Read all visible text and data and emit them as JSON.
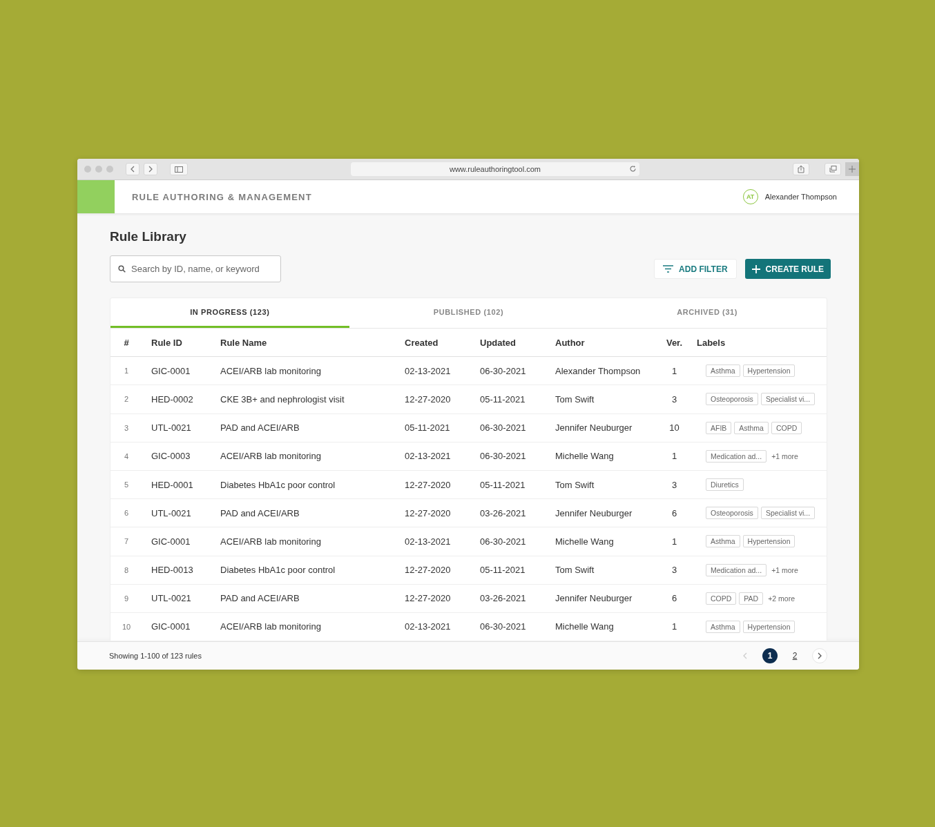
{
  "browser": {
    "url": "www.ruleauthoringtool.com"
  },
  "header": {
    "title": "RULE AUTHORING & MANAGEMENT",
    "user": {
      "initials": "AT",
      "name": "Alexander Thompson"
    }
  },
  "page": {
    "title": "Rule Library"
  },
  "search": {
    "placeholder": "Search by ID, name, or keyword"
  },
  "actions": {
    "filter": "ADD FILTER",
    "create": "CREATE RULE"
  },
  "tabs": [
    {
      "label": "IN PROGRESS (123)",
      "selected": true
    },
    {
      "label": "PUBLISHED (102)",
      "selected": false
    },
    {
      "label": "ARCHIVED (31)",
      "selected": false
    }
  ],
  "table": {
    "columns": [
      "#",
      "Rule ID",
      "Rule Name",
      "Created",
      "Updated",
      "Author",
      "Ver.",
      "Labels"
    ],
    "rows": [
      {
        "num": "1",
        "id": "GIC-0001",
        "name": "ACEI/ARB lab monitoring",
        "created": "02-13-2021",
        "updated": "06-30-2021",
        "author": "Alexander Thompson",
        "ver": "1",
        "labels": [
          "Asthma",
          "Hypertension"
        ]
      },
      {
        "num": "2",
        "id": "HED-0002",
        "name": "CKE 3B+ and nephrologist visit",
        "created": "12-27-2020",
        "updated": "05-11-2021",
        "author": "Tom Swift",
        "ver": "3",
        "labels": [
          "Osteoporosis",
          "Specialist vi..."
        ]
      },
      {
        "num": "3",
        "id": "UTL-0021",
        "name": "PAD and ACEI/ARB",
        "created": "05-11-2021",
        "updated": "06-30-2021",
        "author": "Jennifer Neuburger",
        "ver": "10",
        "labels": [
          "AFIB",
          "Asthma",
          "COPD"
        ]
      },
      {
        "num": "4",
        "id": "GIC-0003",
        "name": "ACEI/ARB lab monitoring",
        "created": "02-13-2021",
        "updated": "06-30-2021",
        "author": "Michelle Wang",
        "ver": "1",
        "labels": [
          "Medication ad..."
        ],
        "more": "+1 more"
      },
      {
        "num": "5",
        "id": "HED-0001",
        "name": "Diabetes HbA1c poor control",
        "created": "12-27-2020",
        "updated": "05-11-2021",
        "author": "Tom Swift",
        "ver": "3",
        "labels": [
          "Diuretics"
        ]
      },
      {
        "num": "6",
        "id": "UTL-0021",
        "name": "PAD and ACEI/ARB",
        "created": "12-27-2020",
        "updated": "03-26-2021",
        "author": "Jennifer Neuburger",
        "ver": "6",
        "labels": [
          "Osteoporosis",
          "Specialist vi..."
        ]
      },
      {
        "num": "7",
        "id": "GIC-0001",
        "name": "ACEI/ARB lab monitoring",
        "created": "02-13-2021",
        "updated": "06-30-2021",
        "author": "Michelle Wang",
        "ver": "1",
        "labels": [
          "Asthma",
          "Hypertension"
        ]
      },
      {
        "num": "8",
        "id": "HED-0013",
        "name": "Diabetes HbA1c poor control",
        "created": "12-27-2020",
        "updated": "05-11-2021",
        "author": "Tom Swift",
        "ver": "3",
        "labels": [
          "Medication ad..."
        ],
        "more": "+1 more"
      },
      {
        "num": "9",
        "id": "UTL-0021",
        "name": "PAD and ACEI/ARB",
        "created": "12-27-2020",
        "updated": "03-26-2021",
        "author": "Jennifer Neuburger",
        "ver": "6",
        "labels": [
          "COPD",
          "PAD"
        ],
        "more": "+2 more"
      },
      {
        "num": "10",
        "id": "GIC-0001",
        "name": "ACEI/ARB lab monitoring",
        "created": "02-13-2021",
        "updated": "06-30-2021",
        "author": "Michelle Wang",
        "ver": "1",
        "labels": [
          "Asthma",
          "Hypertension"
        ]
      }
    ]
  },
  "footer": {
    "summary": "Showing 1-100 of 123 rules",
    "pages": [
      {
        "label": "1",
        "selected": true
      },
      {
        "label": "2",
        "selected": false
      }
    ]
  }
}
